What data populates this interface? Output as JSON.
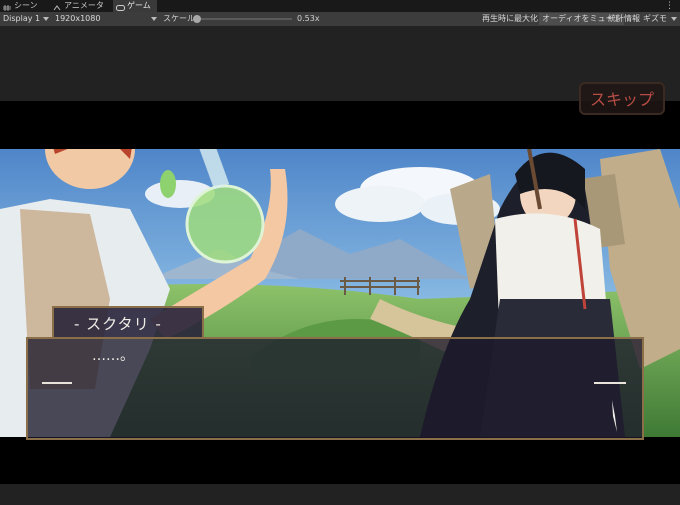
{
  "tabs": [
    {
      "label": "シーン",
      "icon": "grid-icon"
    },
    {
      "label": "アニメーター",
      "icon": "animator-icon"
    },
    {
      "label": "ゲーム",
      "icon": "gamepad-icon",
      "active": true
    }
  ],
  "toolbar": {
    "display": "Display 1",
    "resolution": "1920x1080",
    "scale_label": "スケール",
    "scale_value": "0.53x",
    "scale_level": 0.0,
    "maximize": "再生時に最大化",
    "mute": "オーディオをミュート",
    "stats": "統計情報",
    "gizmos": "ギズモ"
  },
  "game": {
    "skip_label": "スキップ",
    "speaker_name": "- スクタリ -",
    "dialog_text": "……。"
  },
  "colors": {
    "editor_bg": "#222222",
    "toolbar_bg": "#3c3c3c",
    "skip_text": "#b94d45",
    "dialog_border": "#8a6f48"
  }
}
